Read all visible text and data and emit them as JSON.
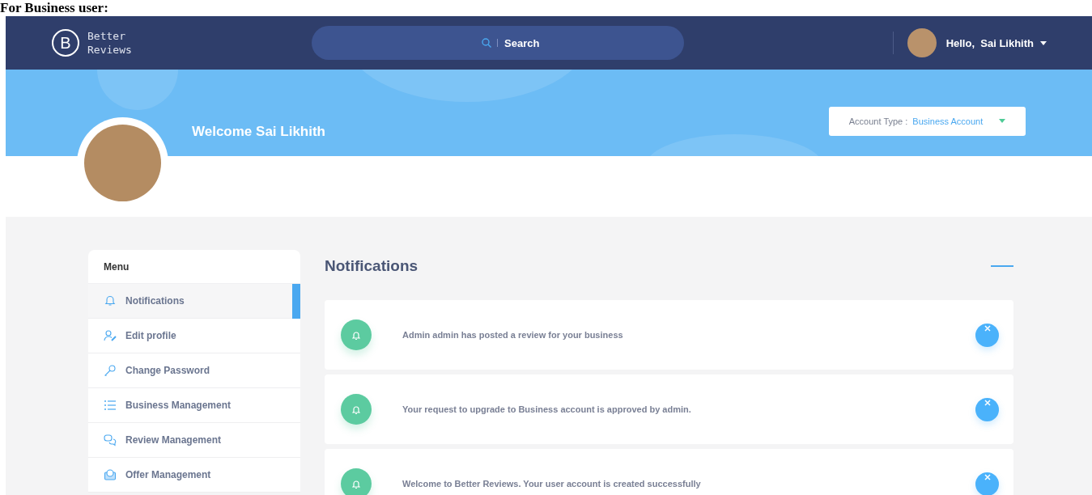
{
  "caption": "For Business user:",
  "header": {
    "logo_letter": "B",
    "logo_text": [
      "Better",
      "Reviews"
    ],
    "search": {
      "placeholder": "Search"
    },
    "greeting": "Hello,  Sai Likhith"
  },
  "banner": {
    "welcome": "Welcome Sai Likhith",
    "account_type": {
      "label": "Account Type :",
      "value": "Business Account"
    }
  },
  "sidebar": {
    "title": "Menu",
    "items": [
      {
        "label": "Notifications",
        "selected": true
      },
      {
        "label": "Edit profile",
        "selected": false
      },
      {
        "label": "Change Password",
        "selected": false
      },
      {
        "label": "Business Management",
        "selected": false
      },
      {
        "label": "Review Management",
        "selected": false
      },
      {
        "label": "Offer Management",
        "selected": false
      }
    ]
  },
  "notifications": {
    "title": "Notifications",
    "items": [
      {
        "text": "Admin admin has posted a review for your business"
      },
      {
        "text": "Your request to upgrade to Business account is approved by admin."
      },
      {
        "text": "Welcome to Better Reviews. Your user account is created successfully"
      }
    ]
  }
}
